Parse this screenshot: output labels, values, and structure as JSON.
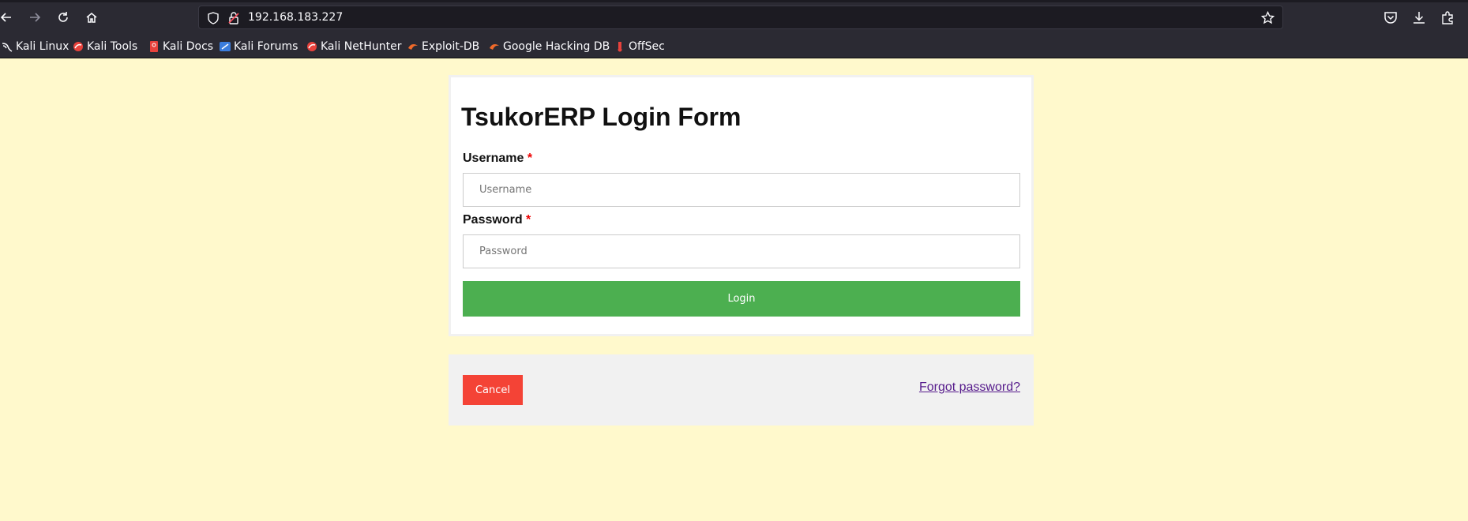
{
  "browser": {
    "url": "192.168.183.227",
    "icons": {
      "back": "back-arrow-icon",
      "forward": "forward-arrow-icon",
      "reload": "reload-icon",
      "home": "home-icon",
      "shield": "tracking-shield-icon",
      "lock": "insecure-lock-icon",
      "star": "bookmark-star-icon",
      "pocket": "pocket-icon",
      "downloads": "download-icon",
      "extensions": "extensions-icon"
    }
  },
  "bookmarks": [
    {
      "label": "Kali Linux",
      "icon": "kali-dragon-icon"
    },
    {
      "label": "Kali Tools",
      "icon": "kali-tools-icon"
    },
    {
      "label": "Kali Docs",
      "icon": "kali-docs-icon"
    },
    {
      "label": "Kali Forums",
      "icon": "kali-forums-icon"
    },
    {
      "label": "Kali NetHunter",
      "icon": "kali-nethunter-icon"
    },
    {
      "label": "Exploit-DB",
      "icon": "exploit-db-icon"
    },
    {
      "label": "Google Hacking DB",
      "icon": "ghdb-icon"
    },
    {
      "label": "OffSec",
      "icon": "offsec-icon"
    }
  ],
  "form": {
    "title": "TsukorERP Login Form",
    "username_label": "Username",
    "username_placeholder": "Username",
    "password_label": "Password",
    "password_placeholder": "Password",
    "required_marker": "*",
    "login_label": "Login"
  },
  "footer": {
    "cancel_label": "Cancel",
    "forgot_label": "Forgot password?"
  },
  "colors": {
    "page_background": "#fff9cc",
    "login_button": "#4caf50",
    "cancel_button": "#f44336",
    "link": "#551a8b"
  }
}
